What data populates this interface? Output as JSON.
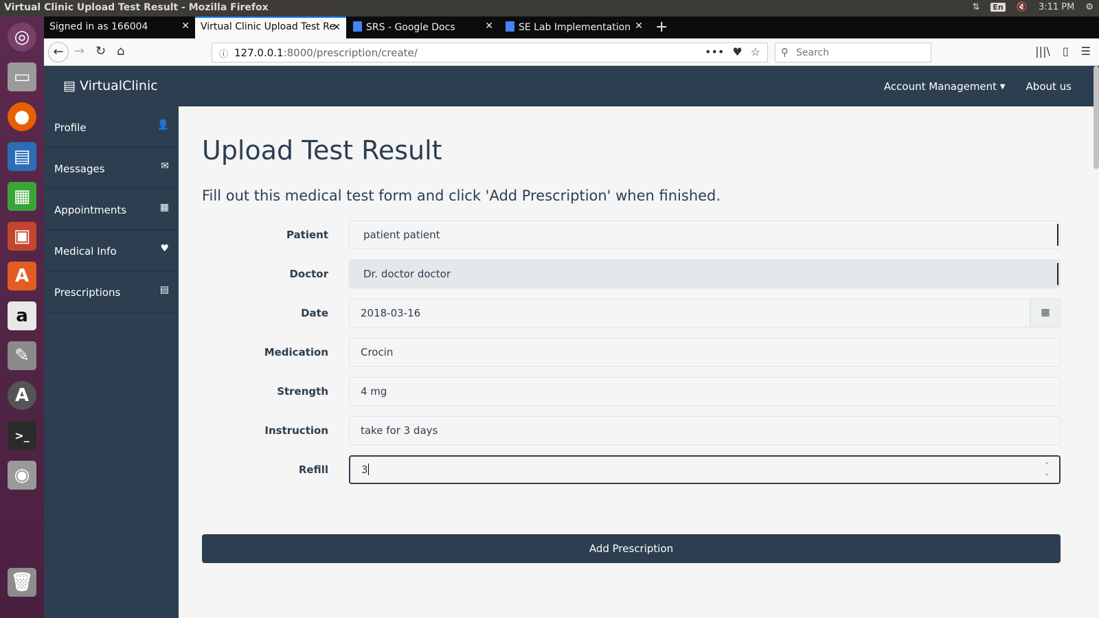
{
  "os": {
    "window_title": "Virtual Clinic Upload Test Result - Mozilla Firefox",
    "lang": "En",
    "clock": "3:11 PM"
  },
  "browser": {
    "tabs": [
      {
        "label": "Signed in as 166004"
      },
      {
        "label": "Virtual Clinic Upload Test Re"
      },
      {
        "label": "SRS - Google Docs"
      },
      {
        "label": "SE Lab Implementation"
      }
    ],
    "url_host": "127.0.0.1",
    "url_path": ":8000/prescription/create/",
    "search_placeholder": "Search"
  },
  "app": {
    "brand": "VirtualClinic",
    "nav": {
      "account": "Account Management",
      "about": "About us"
    },
    "sidebar": [
      {
        "label": "Profile",
        "icon": "user-icon"
      },
      {
        "label": "Messages",
        "icon": "envelope-icon"
      },
      {
        "label": "Appointments",
        "icon": "calendar-icon"
      },
      {
        "label": "Medical Info",
        "icon": "heartbeat-icon"
      },
      {
        "label": "Prescriptions",
        "icon": "file-icon"
      }
    ],
    "page_title": "Upload Test Result",
    "lead": "Fill out this medical test form and click 'Add Prescription' when finished.",
    "form": {
      "patient": {
        "label": "Patient",
        "value": "patient patient"
      },
      "doctor": {
        "label": "Doctor",
        "value": "Dr. doctor doctor"
      },
      "date": {
        "label": "Date",
        "value": "2018-03-16"
      },
      "medication": {
        "label": "Medication",
        "value": "Crocin"
      },
      "strength": {
        "label": "Strength",
        "value": "4 mg"
      },
      "instruction": {
        "label": "Instruction",
        "value": "take for 3 days"
      },
      "refill": {
        "label": "Refill",
        "value": "3"
      }
    },
    "submit_label": "Add Prescription"
  }
}
